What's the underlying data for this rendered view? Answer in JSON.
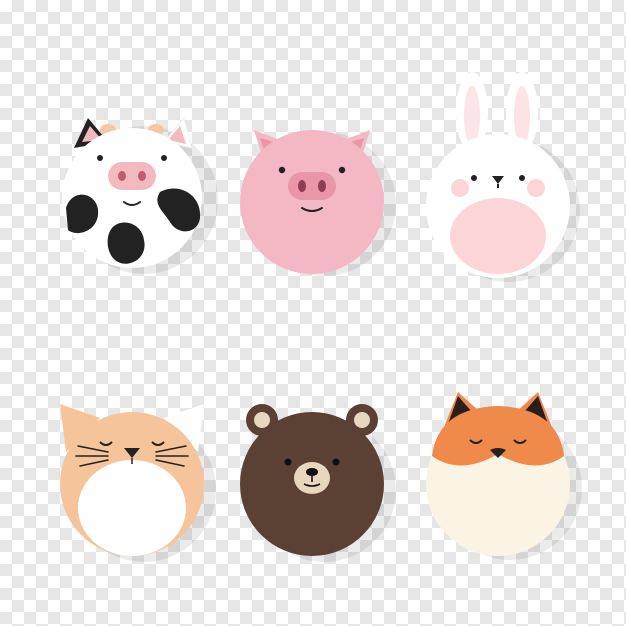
{
  "stickers": [
    {
      "animal": "cow-icon",
      "color": "#ffffff",
      "accent": "#f4b8c0"
    },
    {
      "animal": "pig-icon",
      "color": "#f4b8c4",
      "accent": "#e996a8"
    },
    {
      "animal": "rabbit-icon",
      "color": "#ffffff",
      "accent": "#fcd5d8"
    },
    {
      "animal": "cat-icon",
      "color": "#f6c49a",
      "accent": "#ffffff"
    },
    {
      "animal": "bear-icon",
      "color": "#5a4133",
      "accent": "#e8d6bf"
    },
    {
      "animal": "fox-icon",
      "color": "#f08a4b",
      "accent": "#fbf4e4"
    }
  ],
  "background": {
    "pattern": "transparency-checkerboard",
    "light": "#ffffff",
    "dark": "#e6e6e6"
  }
}
